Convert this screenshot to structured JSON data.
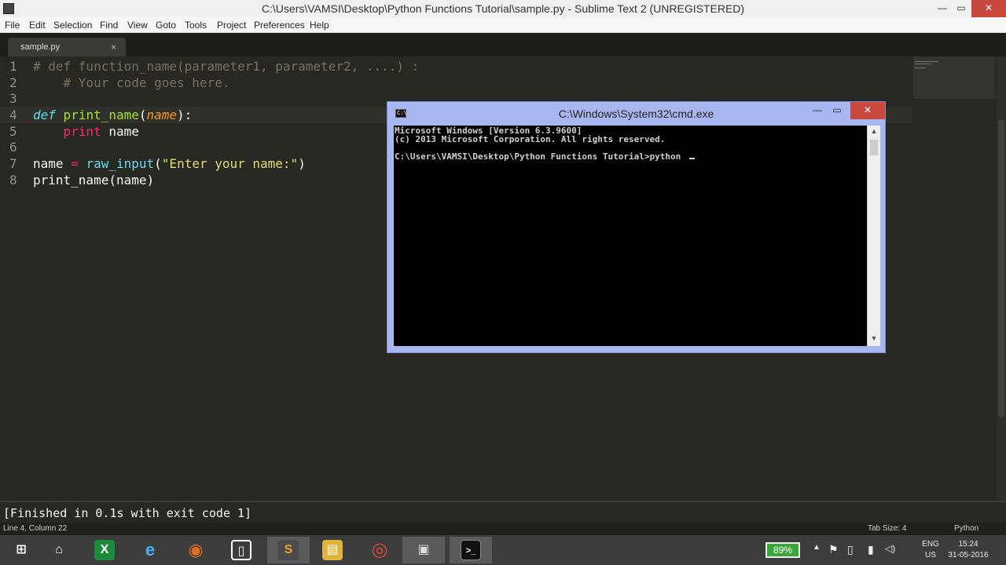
{
  "window": {
    "title": "C:\\Users\\VAMSI\\Desktop\\Python Functions Tutorial\\sample.py - Sublime Text 2 (UNREGISTERED)",
    "minimize_glyph": "—",
    "maximize_glyph": "▭",
    "close_glyph": "✕"
  },
  "menu": {
    "items": [
      "File",
      "Edit",
      "Selection",
      "Find",
      "View",
      "Goto",
      "Tools",
      "Project",
      "Preferences",
      "Help"
    ]
  },
  "tab": {
    "label": "sample.py",
    "close_glyph": "×"
  },
  "editor": {
    "line_numbers": [
      "1",
      "2",
      "3",
      "4",
      "5",
      "6",
      "7",
      "8"
    ],
    "lines": {
      "l1": "# def function_name(parameter1, parameter2, ....) :",
      "l2": "    # Your code goes here.",
      "l4_kw": "def",
      "l4_fn": "print_name",
      "l4_open": "(",
      "l4_param": "name",
      "l4_close": "):",
      "l5_kw": "print",
      "l5_arg": "name",
      "l7_var": "name",
      "l7_op": "=",
      "l7_fn": "raw_input",
      "l7_open": "(",
      "l7_str": "\"Enter your name:\"",
      "l7_close": ")",
      "l8": "print_name(name)"
    }
  },
  "output_panel": {
    "text": "[Finished in 0.1s with exit code 1]"
  },
  "status_bar": {
    "position": "Line 4, Column 22",
    "tab_size": "Tab Size: 4",
    "syntax": "Python"
  },
  "cmd": {
    "title": "C:\\Windows\\System32\\cmd.exe",
    "icon_text": "C:\\",
    "minimize_glyph": "—",
    "maximize_glyph": "▭",
    "close_glyph": "✕",
    "lines": [
      "Microsoft Windows [Version 6.3.9600]",
      "(c) 2013 Microsoft Corporation. All rights reserved.",
      "C:\\Users\\VAMSI\\Desktop\\Python Functions Tutorial>python "
    ],
    "scroll_up": "▲",
    "scroll_down": "▼"
  },
  "taskbar": {
    "apps": [
      {
        "name": "start-button",
        "glyph": "⊞",
        "color": "#3c3c3c"
      },
      {
        "name": "home-icon",
        "glyph": "⌂",
        "color": "#3c3c3c"
      },
      {
        "name": "excel-icon",
        "glyph": "X",
        "color": "#1e8a3c"
      },
      {
        "name": "internet-explorer-icon",
        "glyph": "e",
        "color": "#1e90d8"
      },
      {
        "name": "firefox-icon",
        "glyph": "◉",
        "color": "#e0701e"
      },
      {
        "name": "sticky-app-icon",
        "glyph": "▯",
        "color": "#3c3c3c"
      },
      {
        "name": "sublime-text-icon",
        "glyph": "S",
        "color": "#4a4a4a"
      },
      {
        "name": "file-explorer-icon",
        "glyph": "▤",
        "color": "#e0b43a"
      },
      {
        "name": "chrome-icon",
        "glyph": "◎",
        "color": "#d8423a"
      },
      {
        "name": "window-app-icon",
        "glyph": "▣",
        "color": "#8a8a8a"
      },
      {
        "name": "cmd-icon",
        "glyph": ">_",
        "color": "#111111"
      }
    ],
    "battery": "89%",
    "tray_icons": [
      "▲",
      "⚑",
      "▯",
      "▮",
      "◁)"
    ],
    "lang_top": "ENG",
    "lang_bottom": "US",
    "time": "15:24",
    "date": "31-05-2016"
  }
}
